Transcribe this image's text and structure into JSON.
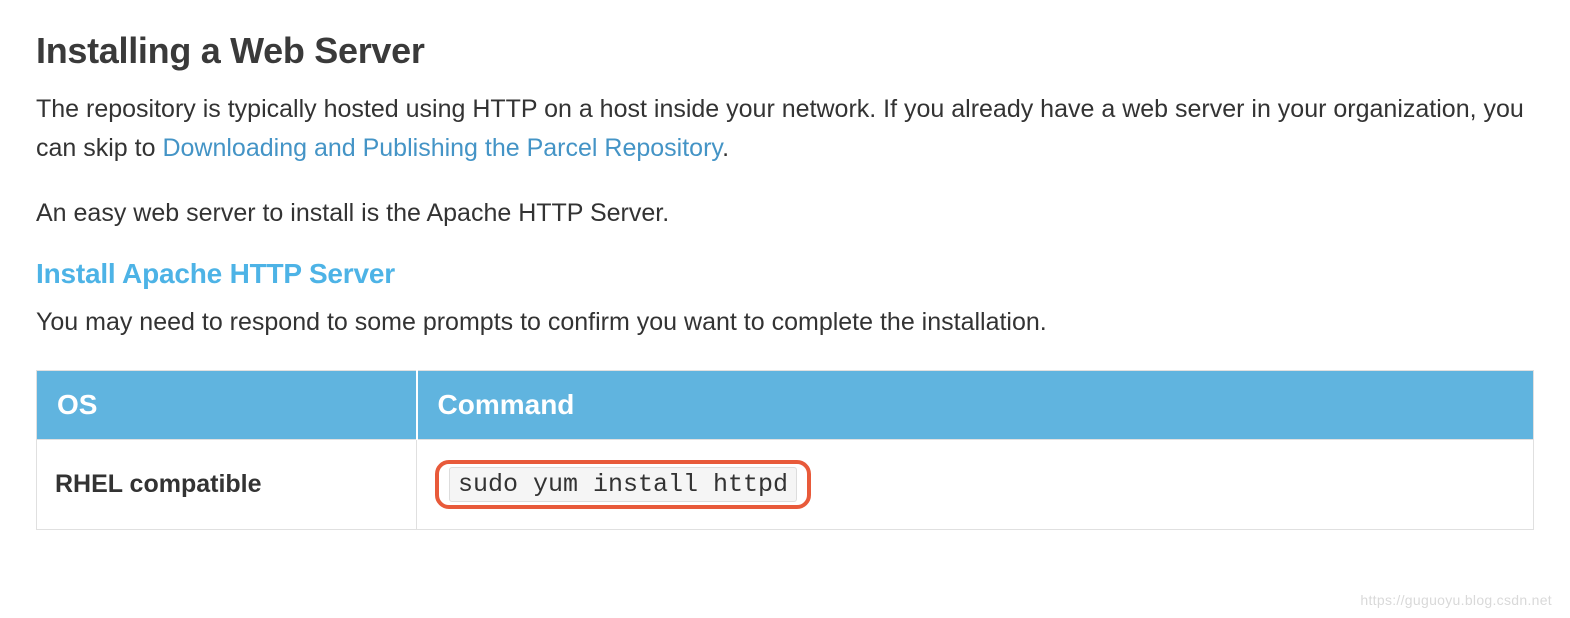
{
  "heading": "Installing a Web Server",
  "paragraph1_part1": "The repository is typically hosted using HTTP on a host inside your network. If you already have a web server in your organization, you can skip to ",
  "paragraph1_link": "Downloading and Publishing the Parcel Repository",
  "paragraph1_part2": ".",
  "paragraph2": "An easy web server to install is the Apache HTTP Server.",
  "subheading": "Install Apache HTTP Server",
  "sub_paragraph": "You may need to respond to some prompts to confirm you want to complete the installation.",
  "table": {
    "headers": {
      "os": "OS",
      "command": "Command"
    },
    "rows": [
      {
        "os": "RHEL compatible",
        "command": "sudo yum install httpd"
      }
    ]
  },
  "watermark": "https://guguoyu.blog.csdn.net"
}
